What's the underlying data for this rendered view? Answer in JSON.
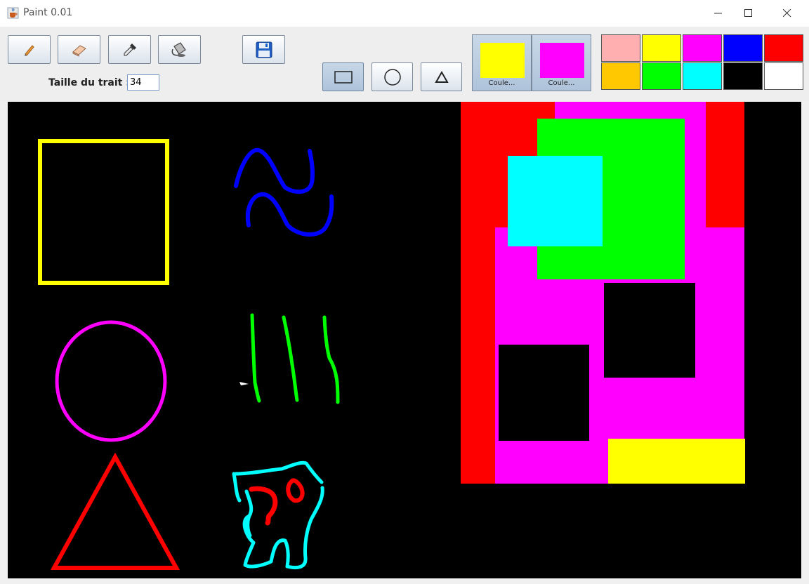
{
  "window": {
    "title": "Paint 0.01",
    "icon": "java-cup-icon",
    "controls": [
      "minimize-icon",
      "maximize-icon",
      "close-icon"
    ]
  },
  "toolbar": {
    "tools": [
      {
        "name": "pencil",
        "icon": "pencil-icon"
      },
      {
        "name": "eraser",
        "icon": "eraser-icon"
      },
      {
        "name": "eyedropper",
        "icon": "eyedropper-icon"
      },
      {
        "name": "fill",
        "icon": "paint-bucket-icon"
      },
      {
        "name": "save",
        "icon": "floppy-disk-icon"
      }
    ],
    "stroke_label": "Taille du trait :",
    "stroke_value": "34",
    "shapes": [
      {
        "name": "rectangle",
        "icon": "rectangle-icon",
        "selected": true
      },
      {
        "name": "circle",
        "icon": "circle-icon",
        "selected": false
      },
      {
        "name": "triangle",
        "icon": "triangle-icon",
        "selected": false
      }
    ],
    "primary_color": {
      "label": "Coule...",
      "color": "#ffff00"
    },
    "secondary_color": {
      "label": "Coule...",
      "color": "#ff00ff"
    },
    "palette": [
      "#ffafaf",
      "#ffff00",
      "#ff00ff",
      "#0000ff",
      "#ff0000",
      "#ffc800",
      "#00ff00",
      "#00ffff",
      "#000000",
      "#ffffff"
    ]
  },
  "canvas": {
    "background": "#000000"
  }
}
